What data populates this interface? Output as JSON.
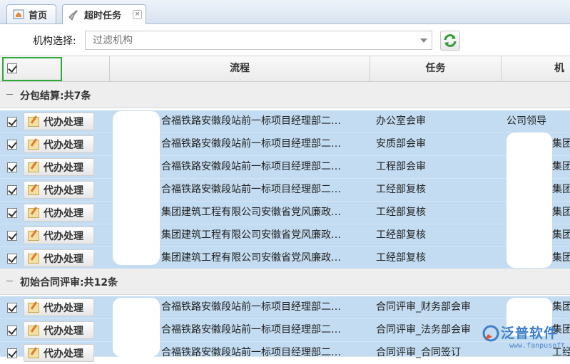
{
  "tabs": [
    {
      "label": "首页",
      "icon": "home-icon"
    },
    {
      "label": "超时任务",
      "icon": "broom-icon",
      "close": "×"
    }
  ],
  "filter": {
    "label": "机构选择:",
    "placeholder": "过滤机构"
  },
  "columns": {
    "flow": "流程",
    "task": "任务",
    "org": "机"
  },
  "action_label": "代办处理",
  "groups": [
    {
      "title": "分包结算:共7条",
      "rows": [
        {
          "flow": "合福铁路安徽段站前一标项目经理部二…",
          "task": "办公室会审",
          "org": "公司领导"
        },
        {
          "flow": "合福铁路安徽段站前一标项目经理部二…",
          "task": "安质部会审",
          "org": "集团"
        },
        {
          "flow": "合福铁路安徽段站前一标项目经理部二…",
          "task": "工程部会审",
          "org": "集团"
        },
        {
          "flow": "合福铁路安徽段站前一标项目经理部二…",
          "task": "工经部复核",
          "org": "集团"
        },
        {
          "flow": "集团建筑工程有限公司安徽省党风廉政…",
          "task": "工经部复核",
          "org": "集团"
        },
        {
          "flow": "集团建筑工程有限公司安徽省党风廉政…",
          "task": "工经部复核",
          "org": "集团"
        },
        {
          "flow": "集团建筑工程有限公司安徽省党风廉政…",
          "task": "工经部复核",
          "org": "集团"
        }
      ]
    },
    {
      "title": "初始合同评审:共12条",
      "rows": [
        {
          "flow": "合福铁路安徽段站前一标项目经理部二…",
          "task": "合同评审_财务部会审",
          "org": "集团"
        },
        {
          "flow": "合福铁路安徽段站前一标项目经理部二…",
          "task": "合同评审_法务部会审",
          "org": "集团"
        },
        {
          "flow": "合福铁路安徽段站前一标项目经理部二…",
          "task": "合同评审_合同签订",
          "org": "工经部"
        }
      ]
    }
  ],
  "watermark": {
    "name": "泛普软件",
    "url": "www.fanpusoft.com"
  },
  "colors": {
    "row_selected": "#c3dcf1",
    "highlight_box": "#2eaa3b",
    "watermark": "#3d7fc9"
  }
}
